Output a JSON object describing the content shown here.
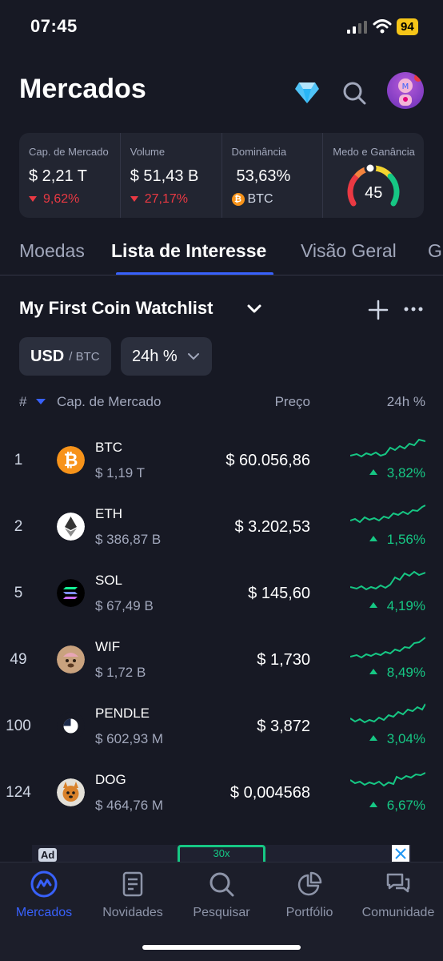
{
  "status_bar": {
    "time": "07:45",
    "battery": "94"
  },
  "header": {
    "title": "Mercados"
  },
  "stats": {
    "market_cap": {
      "label": "Cap. de Mercado",
      "value": "$ 2,21 T",
      "change": "9,62%"
    },
    "volume": {
      "label": "Volume",
      "value": "$ 51,43 B",
      "change": "27,17%"
    },
    "dominance": {
      "label": "Dominância",
      "value": "53,63%",
      "coin": "BTC"
    },
    "fear_greed": {
      "label": "Medo e Ganância",
      "value": "45"
    }
  },
  "tabs": [
    "Moedas",
    "Lista de Interesse",
    "Visão Geral",
    "G"
  ],
  "watchlist": {
    "title": "My First Coin Watchlist"
  },
  "filters": {
    "currency": "USD",
    "alt_currency": "BTC",
    "period": "24h %"
  },
  "table_header": {
    "rank": "#",
    "market_cap": "Cap. de Mercado",
    "price": "Preço",
    "change": "24h %"
  },
  "coins": [
    {
      "rank": "1",
      "symbol": "BTC",
      "mcap": "$ 1,19 T",
      "price": "$ 60.056,86",
      "change": "3,82%",
      "logo_color": "#f7931a"
    },
    {
      "rank": "2",
      "symbol": "ETH",
      "mcap": "$ 386,87 B",
      "price": "$ 3.202,53",
      "change": "1,56%",
      "logo_color": "#ffffff"
    },
    {
      "rank": "5",
      "symbol": "SOL",
      "mcap": "$ 67,49 B",
      "price": "$ 145,60",
      "change": "4,19%",
      "logo_color": "#000000"
    },
    {
      "rank": "49",
      "symbol": "WIF",
      "mcap": "$ 1,72 B",
      "price": "$ 1,730",
      "change": "8,49%",
      "logo_color": "#c9a27e"
    },
    {
      "rank": "100",
      "symbol": "PENDLE",
      "mcap": "$ 602,93 M",
      "price": "$ 3,872",
      "change": "3,04%",
      "logo_color": "#ffffff"
    },
    {
      "rank": "124",
      "symbol": "DOG",
      "mcap": "$ 464,76 M",
      "price": "$ 0,004568",
      "change": "6,67%",
      "logo_color": "#d9822b"
    }
  ],
  "ad": {
    "tag": "Ad",
    "badge": "30x"
  },
  "bottom_nav": [
    {
      "label": "Mercados",
      "icon": "markets-icon",
      "active": true
    },
    {
      "label": "Novidades",
      "icon": "news-icon",
      "active": false
    },
    {
      "label": "Pesquisar",
      "icon": "search-icon",
      "active": false
    },
    {
      "label": "Portfólio",
      "icon": "portfolio-icon",
      "active": false
    },
    {
      "label": "Comunidade",
      "icon": "community-icon",
      "active": false
    }
  ],
  "colors": {
    "accent": "#3861fb",
    "up": "#16c784",
    "down": "#ea3943",
    "background": "#171924"
  }
}
